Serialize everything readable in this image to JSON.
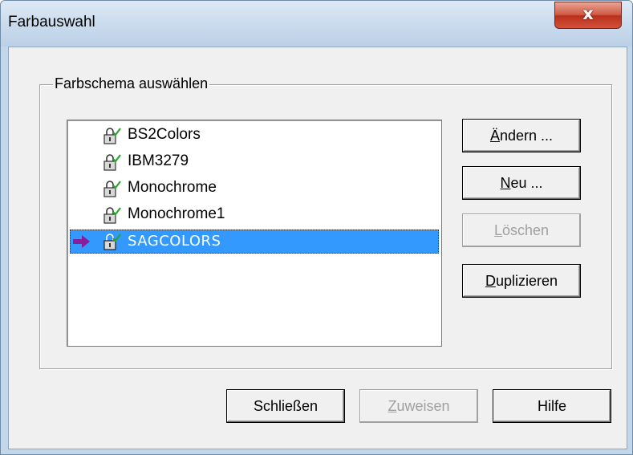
{
  "window": {
    "title": "Farbauswahl",
    "close_label": "x"
  },
  "group": {
    "label": "Farbschema auswählen"
  },
  "schemes": [
    {
      "name": "BS2Colors",
      "selected": false,
      "current": false
    },
    {
      "name": "IBM3279",
      "selected": false,
      "current": false
    },
    {
      "name": "Monochrome",
      "selected": false,
      "current": false
    },
    {
      "name": "Monochrome1",
      "selected": false,
      "current": false
    },
    {
      "name": "SAGCOLORS",
      "selected": true,
      "current": true
    }
  ],
  "side_buttons": {
    "change": {
      "mnemonic": "Ä",
      "rest": "ndern ...",
      "enabled": true
    },
    "new": {
      "mnemonic": "N",
      "rest": "eu ...",
      "enabled": true
    },
    "delete": {
      "mnemonic": "L",
      "rest": "öschen",
      "enabled": false
    },
    "duplicate": {
      "mnemonic": "D",
      "rest": "uplizieren",
      "enabled": true
    }
  },
  "bottom_buttons": {
    "close": {
      "label": "Schließen",
      "enabled": true
    },
    "assign": {
      "mnemonic": "Z",
      "rest": "uweisen",
      "enabled": false
    },
    "help": {
      "label": "Hilfe",
      "enabled": true
    }
  },
  "colors": {
    "selection": "#3399ff",
    "arrow": "#8a1d9a",
    "lock_check": "#2aa52a"
  },
  "icons": {
    "row_lock": "lock-icon",
    "current_marker": "arrow-right-icon"
  }
}
